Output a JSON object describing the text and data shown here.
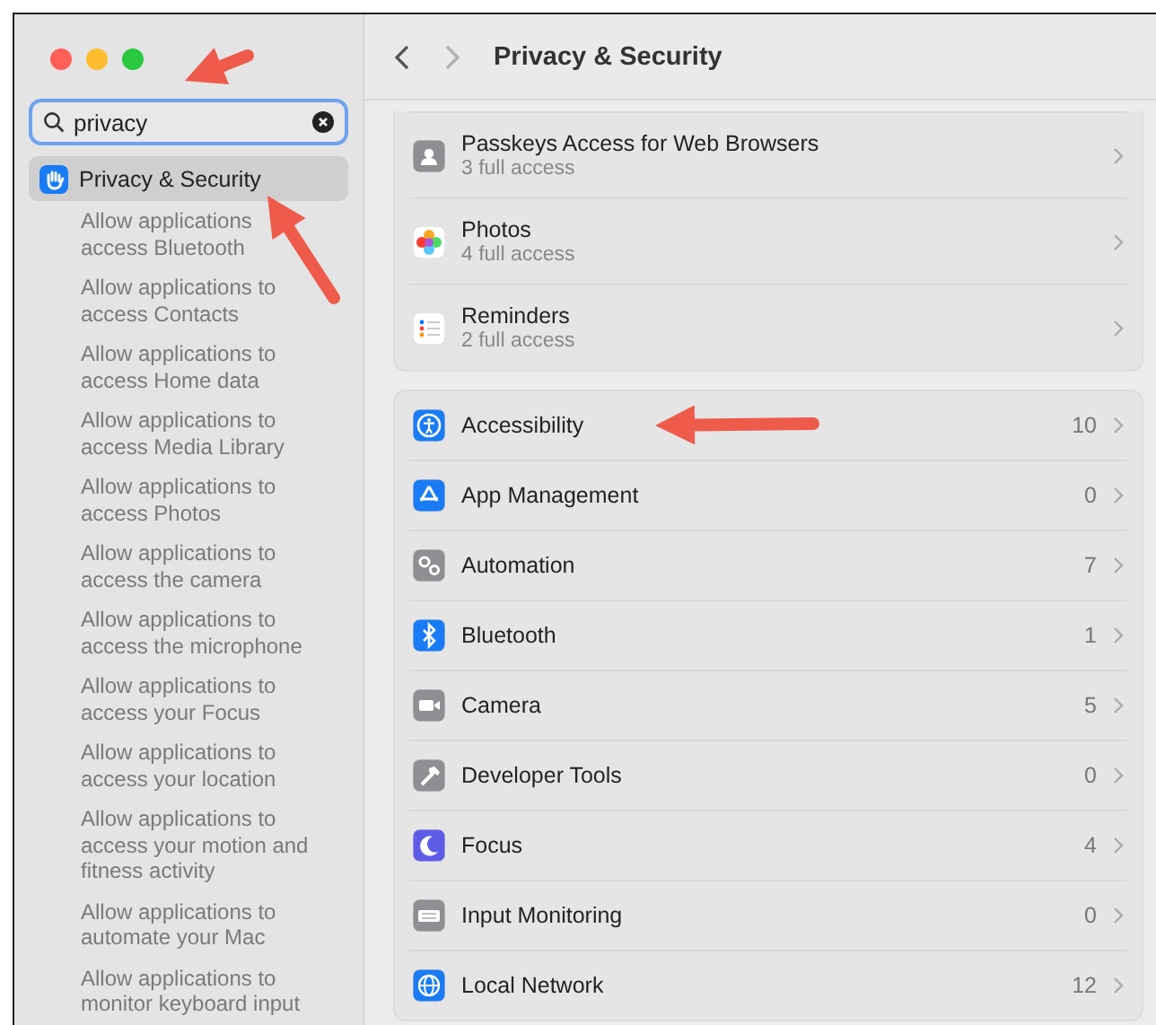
{
  "window": {
    "title": "Privacy & Security"
  },
  "navigation": {
    "back": {
      "disabled": false
    },
    "forward": {
      "disabled": true
    }
  },
  "search": {
    "value": "privacy"
  },
  "sidebar": {
    "items": [
      {
        "label": "Privacy & Security",
        "selected": true,
        "children": [
          {
            "label": "Allow applications\naccess Bluetooth",
            "selected": false
          },
          {
            "label": "Allow applications to\naccess Contacts",
            "selected": false
          },
          {
            "label": "Allow applications to\naccess Home data",
            "selected": false
          },
          {
            "label": "Allow applications to\naccess Media Library",
            "selected": false
          },
          {
            "label": "Allow applications to\naccess Photos",
            "selected": false
          },
          {
            "label": "Allow applications to\naccess the camera",
            "selected": false
          },
          {
            "label": "Allow applications to\naccess the microphone",
            "selected": false
          },
          {
            "label": "Allow applications to\naccess your Focus",
            "selected": false
          },
          {
            "label": "Allow applications to\naccess your location",
            "selected": false
          },
          {
            "label": "Allow applications to\naccess your motion and\nfitness activity",
            "selected": false
          },
          {
            "label": "Allow applications to\nautomate your Mac",
            "selected": false
          },
          {
            "label": "Allow applications to\nmonitor keyboard input",
            "selected": false
          }
        ]
      }
    ]
  },
  "groups": [
    {
      "rows": [
        {
          "title": "Passkeys Access for Web Browsers",
          "subtitle": "3 full access"
        },
        {
          "title": "Photos",
          "subtitle": "4 full access"
        },
        {
          "title": "Reminders",
          "subtitle": "2 full access"
        }
      ]
    },
    {
      "rows": [
        {
          "title": "Accessibility",
          "count": "10"
        },
        {
          "title": "App Management",
          "count": "0"
        },
        {
          "title": "Automation",
          "count": "7"
        },
        {
          "title": "Bluetooth",
          "count": "1"
        },
        {
          "title": "Camera",
          "count": "5"
        },
        {
          "title": "Developer Tools",
          "count": "0"
        },
        {
          "title": "Focus",
          "count": "4"
        },
        {
          "title": "Input Monitoring",
          "count": "0"
        },
        {
          "title": "Local Network",
          "count": "12"
        }
      ]
    }
  ]
}
